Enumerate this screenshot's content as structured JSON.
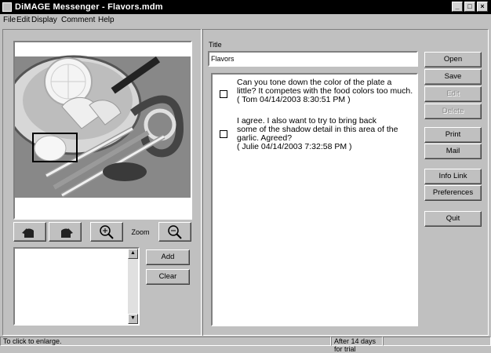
{
  "window": {
    "title": "DiMAGE Messenger - Flavors.mdm"
  },
  "menu": [
    "File",
    "Edit",
    "Display",
    "Comment",
    "Help"
  ],
  "left": {
    "zoom_label": "Zoom",
    "add_label": "Add",
    "clear_label": "Clear"
  },
  "right": {
    "title_label": "Title",
    "title_value": "Flavors",
    "comments": [
      {
        "lines": [
          "Can you tone down the color of the plate a",
          "little? It competes with the food colors too much.",
          "( Tom  04/14/2003 8:30:51 PM )"
        ]
      },
      {
        "lines": [
          "I agree. I also want to try to bring back",
          "some of the shadow detail in this area of the",
          "garlic. Agreed?",
          "( Julie  04/14/2003 7:32:58 PM )"
        ]
      }
    ],
    "buttons": {
      "open": "Open",
      "save": "Save",
      "edit": "Edit",
      "delete": "Delete",
      "print": "Print",
      "mail": "Mail",
      "info_link": "Info Link",
      "preferences": "Preferences",
      "quit": "Quit"
    }
  },
  "status": {
    "left": "To click to enlarge.",
    "middle": "After 14 days for trial"
  }
}
